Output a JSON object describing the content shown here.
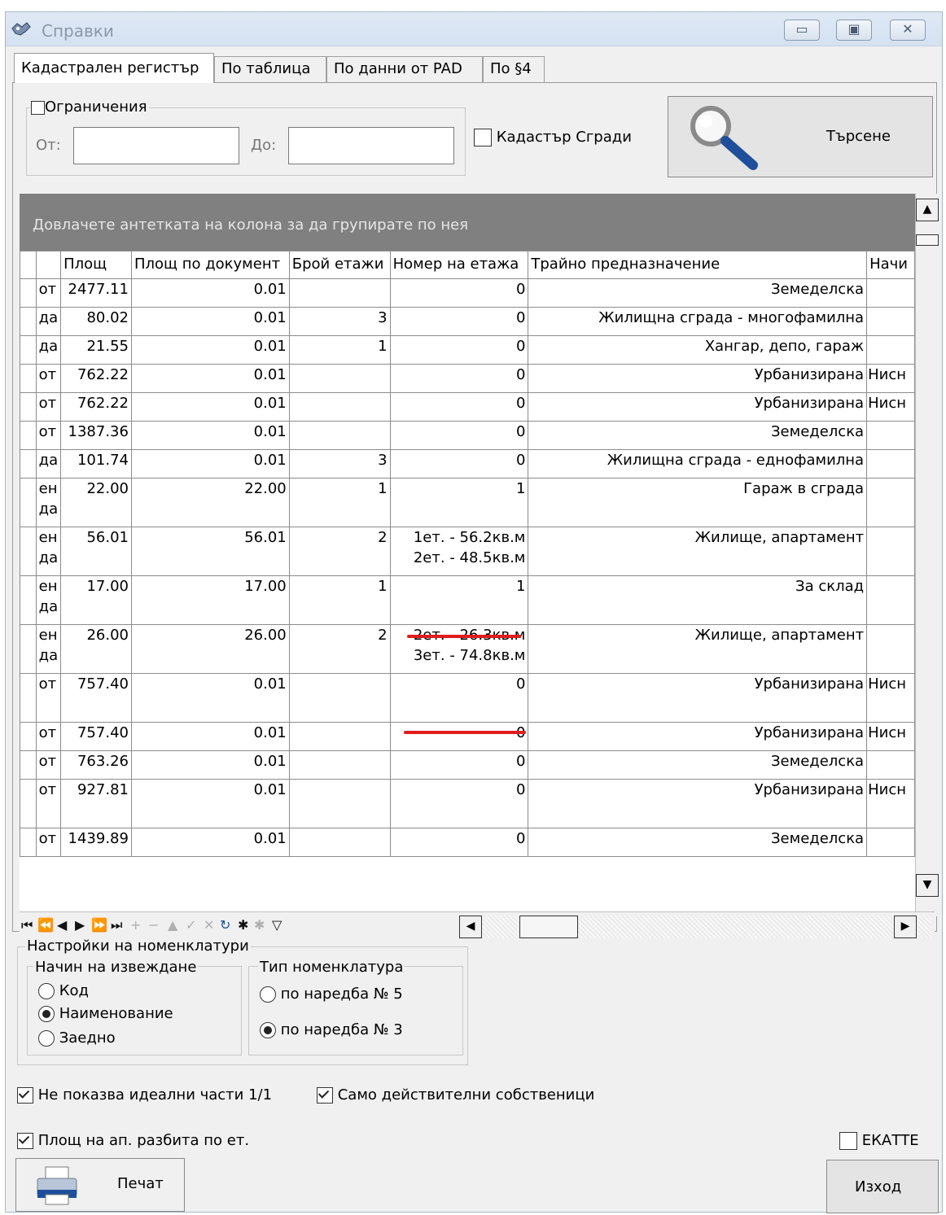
{
  "window": {
    "title": "Справки",
    "controls": {
      "minimize": "▭",
      "maximize": "▣",
      "close": "✕"
    }
  },
  "tabs": [
    "Кадастрален регистър",
    "По таблица",
    "По данни от PAD",
    "По §4"
  ],
  "filter": {
    "limits_label": "Ограничения",
    "from_label": "От:",
    "to_label": "До:",
    "from_value": "",
    "to_value": "",
    "kadastar_label": "Кадастър Сгради",
    "search_label": "Търсене"
  },
  "grid": {
    "group_hint": "Довлачете антетката на колона за да групирате по нея",
    "columns": [
      "",
      "Площ",
      "Площ по документ",
      "Брой етажи",
      "Номер на етажа",
      "Трайно предназначение",
      "Начи"
    ],
    "rows": [
      {
        "ind": "от",
        "area": "2477.11",
        "doc": "0.01",
        "floors": "",
        "floor_no": "0",
        "purpose": "Земеделска",
        "extra": ""
      },
      {
        "ind": "да",
        "area": "80.02",
        "doc": "0.01",
        "floors": "3",
        "floor_no": "0",
        "purpose": "Жилищна сграда - многофамилна",
        "extra": ""
      },
      {
        "ind": "да",
        "area": "21.55",
        "doc": "0.01",
        "floors": "1",
        "floor_no": "0",
        "purpose": "Хангар, депо, гараж",
        "extra": ""
      },
      {
        "ind": "от",
        "area": "762.22",
        "doc": "0.01",
        "floors": "",
        "floor_no": "0",
        "purpose": "Урбанизирана",
        "extra": "Нисн"
      },
      {
        "ind": "от",
        "area": "762.22",
        "doc": "0.01",
        "floors": "",
        "floor_no": "0",
        "purpose": "Урбанизирана",
        "extra": "Нисн"
      },
      {
        "ind": "от",
        "area": "1387.36",
        "doc": "0.01",
        "floors": "",
        "floor_no": "0",
        "purpose": "Земеделска",
        "extra": ""
      },
      {
        "ind": "да",
        "area": "101.74",
        "doc": "0.01",
        "floors": "3",
        "floor_no": "0",
        "purpose": "Жилищна сграда - еднофамилна",
        "extra": ""
      },
      {
        "ind": "ен",
        "ind2": "да",
        "area": "22.00",
        "doc": "22.00",
        "floors": "1",
        "floor_no": "1",
        "purpose": "Гараж в сграда",
        "extra": ""
      },
      {
        "ind": "ен",
        "ind2": "да",
        "area": "56.01",
        "doc": "56.01",
        "floors": "2",
        "floor_no": "1ет. - 56.2кв.м",
        "floor_no2": "2ет. - 48.5кв.м",
        "purpose": "Жилище, апартамент",
        "extra": ""
      },
      {
        "ind": "ен",
        "ind2": "да",
        "area": "17.00",
        "doc": "17.00",
        "floors": "1",
        "floor_no": "1",
        "purpose": "За склад",
        "extra": ""
      },
      {
        "ind": "ен",
        "ind2": "да",
        "area": "26.00",
        "doc": "26.00",
        "floors": "2",
        "floor_no": "2ет. - 26.3кв.м",
        "floor_no2": "3ет. - 74.8кв.м",
        "purpose": "Жилище, апартамент",
        "extra": ""
      },
      {
        "ind": "от",
        "area": "757.40",
        "doc": "0.01",
        "floors": "",
        "floor_no": "0",
        "purpose": "Урбанизирана",
        "extra": "Нисн"
      },
      {
        "ind": "от",
        "area": "757.40",
        "doc": "0.01",
        "floors": "",
        "floor_no": "0",
        "purpose": "Урбанизирана",
        "extra": "Нисн"
      },
      {
        "ind": "от",
        "area": "763.26",
        "doc": "0.01",
        "floors": "",
        "floor_no": "0",
        "purpose": "Земеделска",
        "extra": ""
      },
      {
        "ind": "от",
        "area": "927.81",
        "doc": "0.01",
        "floors": "",
        "floor_no": "0",
        "purpose": "Урбанизирана",
        "extra": "Нисн"
      },
      {
        "ind": "от",
        "area": "1439.89",
        "doc": "0.01",
        "floors": "",
        "floor_no": "0",
        "purpose": "Земеделска",
        "extra": ""
      }
    ]
  },
  "nomenclature": {
    "group_label": "Настройки на номенклатури",
    "mode_label": "Начин на извеждане",
    "mode_options": [
      "Код",
      "Наименование",
      "Заедно"
    ],
    "mode_selected": "Наименование",
    "type_label": "Тип номенклатура",
    "type_options": [
      "по наредба № 5",
      "по наредба № 3"
    ],
    "type_selected": "по наредба № 3"
  },
  "options": {
    "ideal_parts": {
      "label": "Не показва идеални части 1/1",
      "checked": true
    },
    "real_owners": {
      "label": "Само действителни собственици",
      "checked": true
    },
    "area_by_floor": {
      "label": "Площ на ап. разбита по ет.",
      "checked": true
    },
    "ekatte": {
      "label": "ЕКАТТЕ",
      "checked": false
    }
  },
  "buttons": {
    "print": "Печат",
    "exit": "Изход"
  },
  "colors": {
    "annotation": "#e01c1c",
    "group_panel": "#808080"
  }
}
